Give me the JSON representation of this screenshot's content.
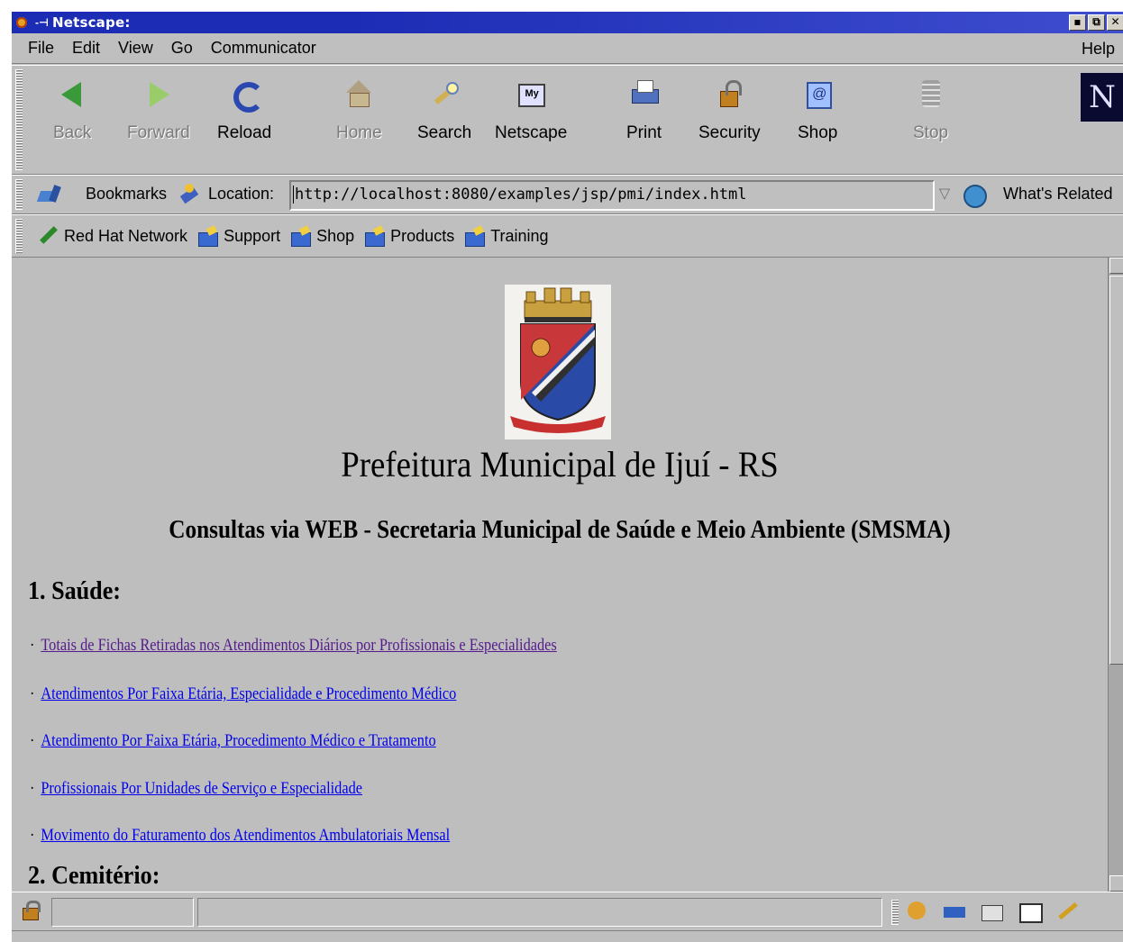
{
  "window": {
    "title": "Netscape:",
    "buttons": [
      "▪",
      "⧉",
      "✕"
    ]
  },
  "menu": {
    "items": [
      "File",
      "Edit",
      "View",
      "Go",
      "Communicator"
    ],
    "help": "Help"
  },
  "nav_toolbar": {
    "buttons": [
      {
        "label": "Back",
        "icon": "back-arrow-icon",
        "enabled": false
      },
      {
        "label": "Forward",
        "icon": "forward-arrow-icon",
        "enabled": false
      },
      {
        "label": "Reload",
        "icon": "reload-icon",
        "enabled": true
      },
      {
        "label": "Home",
        "icon": "home-icon",
        "enabled": false
      },
      {
        "label": "Search",
        "icon": "search-icon",
        "enabled": true
      },
      {
        "label": "Netscape",
        "icon": "my-netscape-icon",
        "enabled": true
      },
      {
        "label": "Print",
        "icon": "print-icon",
        "enabled": true
      },
      {
        "label": "Security",
        "icon": "lock-icon",
        "enabled": true
      },
      {
        "label": "Shop",
        "icon": "shop-icon",
        "enabled": true
      },
      {
        "label": "Stop",
        "icon": "stop-icon",
        "enabled": false
      }
    ],
    "logo": "N"
  },
  "location_toolbar": {
    "bookmarks_label": "Bookmarks",
    "location_label": "Location:",
    "url": "http://localhost:8080/examples/jsp/pmi/index.html",
    "whats_related": "What's Related"
  },
  "personal_toolbar": {
    "items": [
      "Red Hat Network",
      "Support",
      "Shop",
      "Products",
      "Training"
    ]
  },
  "page": {
    "title": "Prefeitura Municipal de Ijuí - RS",
    "subtitle": "Consultas via WEB  -  Secretaria Municipal de Saúde e Meio Ambiente (SMSMA)",
    "sections": [
      {
        "heading": "1. Saúde:",
        "links": [
          {
            "text": "Totais de Fichas Retiradas nos Atendimentos Diários por Profissionais e Especialidades",
            "visited": true
          },
          {
            "text": "Atendimentos Por Faixa Etária, Especialidade e Procedimento Médico",
            "visited": false
          },
          {
            "text": "Atendimento Por Faixa Etária, Procedimento Médico e Tratamento",
            "visited": false
          },
          {
            "text": "Profissionais Por Unidades de Serviço e Especialidade",
            "visited": false
          },
          {
            "text": "Movimento do Faturamento dos Atendimentos Ambulatoriais Mensal",
            "visited": false
          }
        ]
      },
      {
        "heading": "2. Cemitério:",
        "links": []
      }
    ],
    "bullet": "·"
  },
  "colors": {
    "titlebar": "#1c2cb4",
    "chrome": "#bfbfbf",
    "link": "#0000ee",
    "visited_link": "#551a8b"
  }
}
